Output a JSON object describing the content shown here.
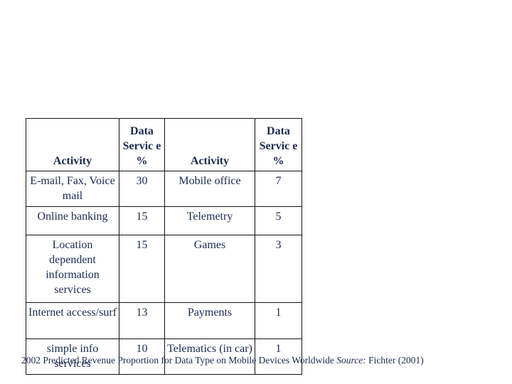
{
  "table": {
    "headers": [
      "Activity",
      "Data Servic e %",
      "Activity",
      "Data Servic e %"
    ],
    "rows": [
      [
        "E-mail, Fax, Voice mail",
        "30",
        "Mobile office",
        "7"
      ],
      [
        "Online banking",
        "15",
        "Telemetry",
        "5"
      ],
      [
        "Location dependent information services",
        "15",
        "Games",
        "3"
      ],
      [
        "Internet access/surf",
        "13",
        "Payments",
        "1"
      ],
      [
        "simple info services",
        "10",
        "Telematics (in car)",
        "1"
      ]
    ]
  },
  "caption": {
    "text": "2002 Predicted Revenue Proportion for Data Type on Mobile Devices Worldwide ",
    "source_label": "Source:",
    "source_text": " Fichter (2001)"
  }
}
